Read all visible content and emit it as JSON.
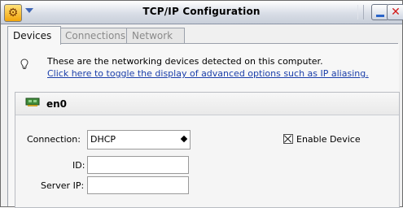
{
  "window": {
    "title": "TCP/IP Configuration"
  },
  "tabs": [
    {
      "label": "Devices",
      "active": true
    },
    {
      "label": "Connections",
      "active": false
    },
    {
      "label": "Network",
      "active": false
    }
  ],
  "info": {
    "text": "These are the networking devices detected on this computer.",
    "link": "Click here to toggle the display of advanced options such as IP aliasing."
  },
  "device": {
    "name": "en0",
    "connection_label": "Connection:",
    "connection_value": "DHCP",
    "enable_label": "Enable Device",
    "enable_checked": true,
    "id_label": "ID:",
    "id_value": "",
    "server_ip_label": "Server IP:",
    "server_ip_value": ""
  },
  "icons": {
    "system_menu": "gear-icon",
    "dropdown": "chevron-down-icon",
    "minimize": "minimize-icon",
    "close": "close-icon",
    "info": "lightbulb-icon",
    "device": "network-card-icon"
  },
  "colors": {
    "link": "#1b3faa",
    "close": "#d11a1a",
    "titlebar": "#d9dee7"
  }
}
